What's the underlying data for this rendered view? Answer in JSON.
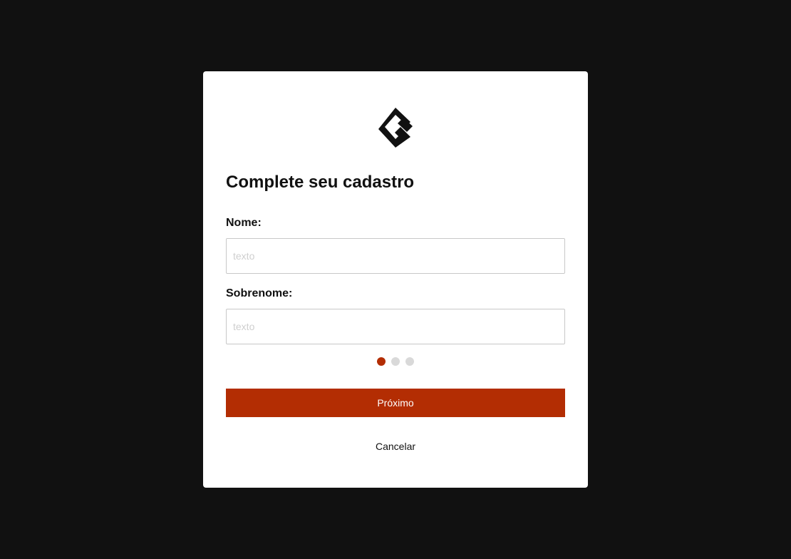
{
  "modal": {
    "title": "Complete seu cadastro",
    "logo_icon": "brand-logo-icon"
  },
  "form": {
    "first_name": {
      "label": "Nome:",
      "value": "",
      "placeholder": "texto"
    },
    "last_name": {
      "label": "Sobrenome:",
      "value": "",
      "placeholder": "texto"
    }
  },
  "stepper": {
    "current_step": 1,
    "total_steps": 3
  },
  "actions": {
    "next_label": "Próximo",
    "cancel_label": "Cancelar"
  },
  "colors": {
    "backdrop": "#111111",
    "accent": "#b32d03",
    "dot_inactive": "#d9d9d9"
  }
}
